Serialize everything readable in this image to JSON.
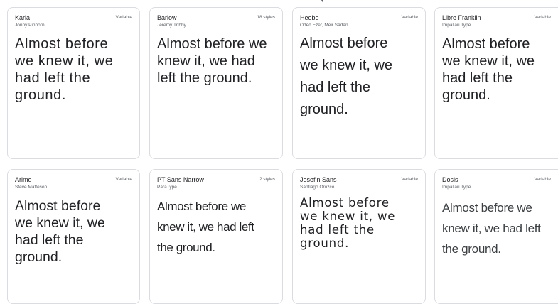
{
  "cards": [
    {
      "name": "Karla",
      "designer": "Jonny Pinhorn",
      "styles": "Variable",
      "sample": "Almost before we knew it, we had left the ground."
    },
    {
      "name": "Barlow",
      "designer": "Jeremy Tribby",
      "styles": "18 styles",
      "sample": "Almost before we knew it, we had left the ground."
    },
    {
      "name": "Heebo",
      "designer": "Oded Ezer, Meir Sadan",
      "styles": "Variable",
      "sample": "Almost before we knew it, we had left the ground."
    },
    {
      "name": "Libre Franklin",
      "designer": "Impallari Type",
      "styles": "Variable",
      "sample": "Almost before we knew it, we had left the ground."
    },
    {
      "name": "Arimo",
      "designer": "Steve Matteson",
      "styles": "Variable",
      "sample": "Almost before we knew it, we had left the ground."
    },
    {
      "name": "PT Sans Narrow",
      "designer": "ParaType",
      "styles": "2 styles",
      "sample": "Almost before we knew it, we had left the ground."
    },
    {
      "name": "Josefin Sans",
      "designer": "Santiago Orozco",
      "styles": "Variable",
      "sample": "Almost before we knew it, we had left the ground."
    },
    {
      "name": "Dosis",
      "designer": "Impallari Type",
      "styles": "Variable",
      "sample": "Almost before we knew it, we had left the ground."
    }
  ]
}
